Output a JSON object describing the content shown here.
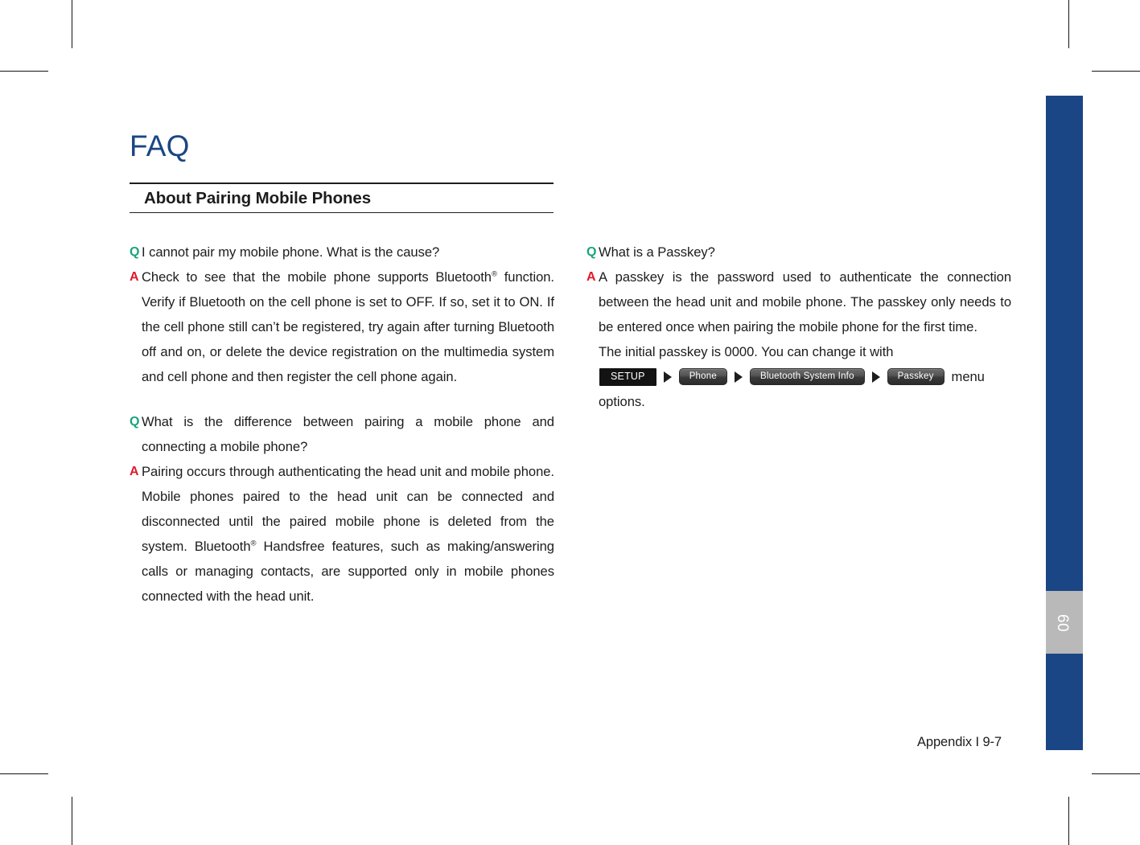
{
  "page": {
    "title": "FAQ",
    "section_heading": "About Pairing Mobile Phones",
    "chapter_tab": "09",
    "footer": "Appendix I 9-7",
    "colors": {
      "accent_blue": "#1b4685",
      "question_marker": "#19a37d",
      "answer_marker": "#e0192b",
      "chapter_tab_gray": "#b9b9b9",
      "chip_flat": "#131313"
    }
  },
  "left_column": {
    "blocks": [
      {
        "question_marker": "Q",
        "question": "I cannot pair my mobile phone. What is the cause?",
        "answer_marker": "A",
        "answer_part1": "Check to see that the mobile phone supports Bluetooth",
        "answer_sup": "®",
        "answer_part2": " function. Verify if Bluetooth on the cell phone is set to OFF. If so, set it to ON. If the cell phone still can’t be registered, try again after turning Bluetooth off and on, or delete the device registration on the multimedia system and cell phone and then register the cell phone again."
      },
      {
        "question_marker": "Q",
        "question": "What is the difference between pairing a mobile phone and connecting a mobile phone?",
        "answer_marker": "A",
        "answer_part1": "Pairing occurs through authenticating the head unit and mobile phone. Mobile phones paired to the head unit can be connected and disconnected until the paired mobile phone is deleted from the system. Bluetooth",
        "answer_sup": "®",
        "answer_part2": " Handsfree features, such as making/answering calls or managing contacts, are supported only in mobile phones connected with the head unit."
      }
    ]
  },
  "right_column": {
    "blocks": [
      {
        "question_marker": "Q",
        "question": "What is a Passkey?",
        "answer_marker": "A",
        "answer_part1": "A passkey is the password used to authenticate the connection between the head unit and mobile phone. The passkey only needs to be entered once when pairing the mobile phone for the first time.",
        "answer_part2": "The initial passkey is 0000. You can change it with",
        "menu_path": [
          {
            "label": "SETUP",
            "style": "flat"
          },
          {
            "label": "Phone",
            "style": "round"
          },
          {
            "label": "Bluetooth System Info",
            "style": "round"
          },
          {
            "label": "Passkey",
            "style": "round"
          }
        ],
        "menu_suffix": "menu",
        "answer_part3": "options."
      }
    ]
  }
}
